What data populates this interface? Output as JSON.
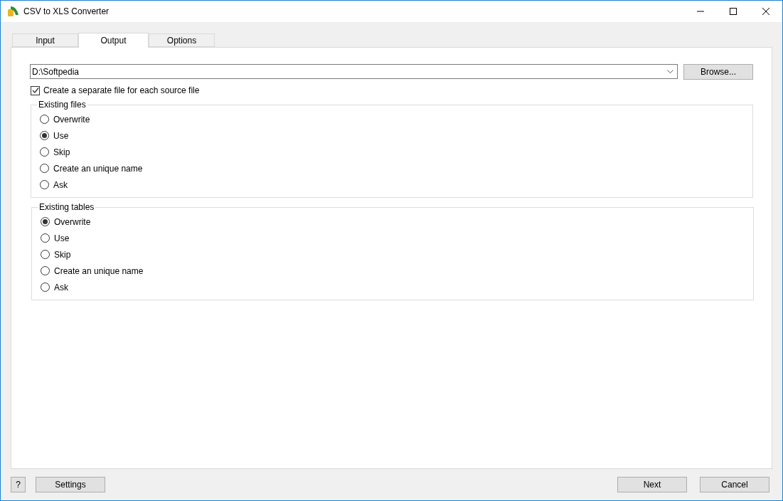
{
  "window": {
    "title": "CSV to XLS Converter"
  },
  "tabs": [
    {
      "label": "Input",
      "selected": false
    },
    {
      "label": "Output",
      "selected": true
    },
    {
      "label": "Options",
      "selected": false
    }
  ],
  "output_folder": {
    "value": "D:\\Softpedia"
  },
  "browse_button": "Browse...",
  "separate_file": {
    "label": "Create a separate file for each source file",
    "checked": true
  },
  "groups": [
    {
      "title": "Existing files",
      "options": [
        {
          "label": "Overwrite",
          "selected": false
        },
        {
          "label": "Use",
          "selected": true
        },
        {
          "label": "Skip",
          "selected": false
        },
        {
          "label": "Create an unique name",
          "selected": false
        },
        {
          "label": "Ask",
          "selected": false
        }
      ]
    },
    {
      "title": "Existing tables",
      "options": [
        {
          "label": "Overwrite",
          "selected": true
        },
        {
          "label": "Use",
          "selected": false
        },
        {
          "label": "Skip",
          "selected": false
        },
        {
          "label": "Create an unique name",
          "selected": false
        },
        {
          "label": "Ask",
          "selected": false
        }
      ]
    }
  ],
  "footer": {
    "help": "?",
    "settings": "Settings",
    "next": "Next",
    "cancel": "Cancel"
  }
}
